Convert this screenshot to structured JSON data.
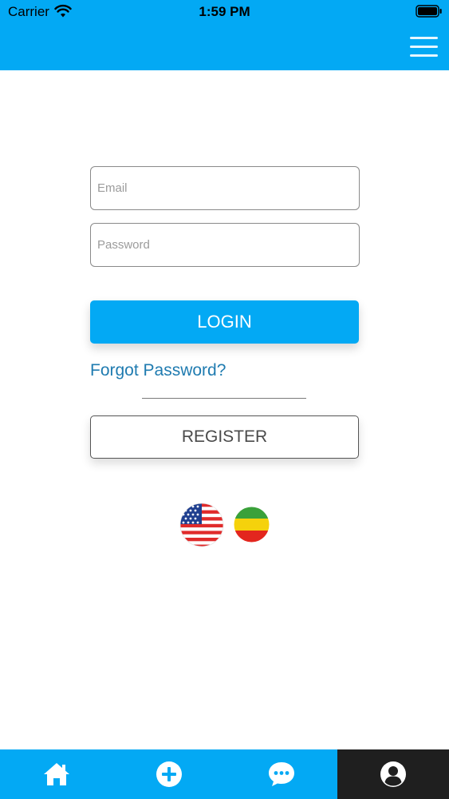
{
  "status_bar": {
    "carrier": "Carrier",
    "time": "1:59 PM"
  },
  "header": {
    "menu_icon": "hamburger-menu-icon",
    "background_color": "#03a9f4"
  },
  "login_form": {
    "email_placeholder": "Email",
    "email_value": "",
    "password_placeholder": "Password",
    "password_value": "",
    "login_label": "LOGIN",
    "forgot_password_label": "Forgot Password?",
    "register_label": "REGISTER"
  },
  "languages": [
    {
      "icon": "us-flag-icon"
    },
    {
      "icon": "ethiopia-flag-icon"
    }
  ],
  "tab_bar": {
    "tabs": [
      {
        "icon": "home-icon",
        "active": false
      },
      {
        "icon": "plus-circle-icon",
        "active": false
      },
      {
        "icon": "chat-bubble-icon",
        "active": false
      },
      {
        "icon": "user-profile-icon",
        "active": true
      }
    ],
    "active_color": "#1f1f1f"
  },
  "colors": {
    "accent": "#03a9f4",
    "link": "#1f7bb0"
  }
}
